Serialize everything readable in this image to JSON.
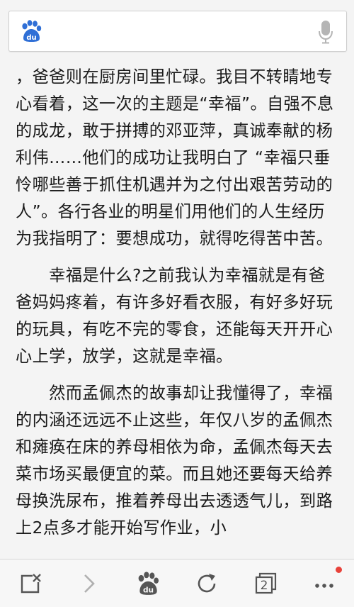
{
  "search": {
    "placeholder": "",
    "logo_text": "du"
  },
  "article": {
    "paragraphs": [
      "，爸爸则在厨房间里忙碌。我目不转睛地专心看着，这一次的主题是“幸福”。自强不息的成龙，敢于拼搏的邓亚萍，真诚奉献的杨利伟……他们的成功让我明白了 “幸福只垂怜哪些善于抓住机遇并为之付出艰苦劳动的人”。各行各业的明星们用他们的人生经历为我指明了：要想成功，就得吃得苦中苦。",
      "　　幸福是什么?之前我认为幸福就是有爸爸妈妈疼着，有许多好看衣服，有好多好玩的玩具，有吃不完的零食，还能每天开开心心上学，放学，这就是幸福。",
      "　　然而孟佩杰的故事却让我懂得了，幸福的内涵还远远不止这些，年仅八岁的孟佩杰和瘫痪在床的养母相依为命，孟佩杰每天去菜市场买最便宜的菜。而且她还要每天给养母换洗尿布，推着养母出去透透气儿，到路上2点多才能开始写作业，小"
    ]
  },
  "bottom_nav": {
    "tab_count": "2",
    "icons": [
      "close-page-icon",
      "forward-icon",
      "baidu-home-icon",
      "refresh-icon",
      "tabs-icon",
      "more-icon"
    ]
  },
  "colors": {
    "baidu_blue": "#2f6fd6",
    "icon_gray": "#555555",
    "notification_red": "#e8423a",
    "text": "#1a1a1a",
    "background": "#f4f4f4"
  }
}
